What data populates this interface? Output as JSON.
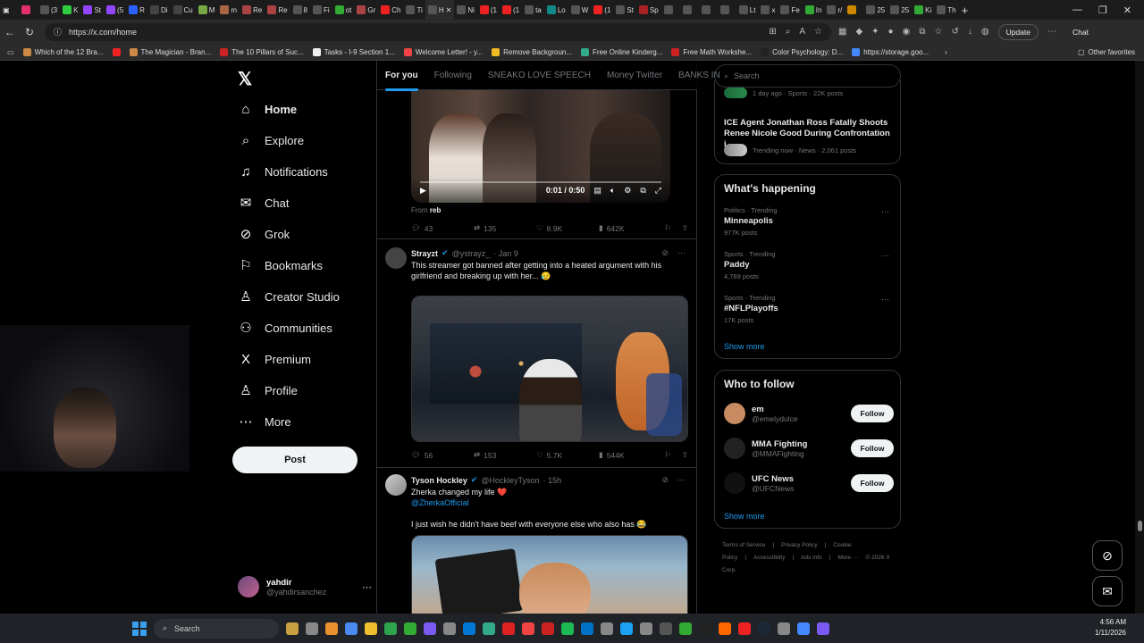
{
  "browser": {
    "tabs": [
      {
        "label": "",
        "color": "#e1306c"
      },
      {
        "label": "(3",
        "color": "#555"
      },
      {
        "label": "K",
        "color": "#2ecc40"
      },
      {
        "label": "St",
        "color": "#9146ff"
      },
      {
        "label": "(5",
        "color": "#9146ff"
      },
      {
        "label": "R",
        "color": "#2962ff"
      },
      {
        "label": "Di",
        "color": "#444"
      },
      {
        "label": "Cu",
        "color": "#444"
      },
      {
        "label": "M",
        "color": "#7a4"
      },
      {
        "label": "m",
        "color": "#a64"
      },
      {
        "label": "Re",
        "color": "#a44"
      },
      {
        "label": "Re",
        "color": "#a44"
      },
      {
        "label": "8",
        "color": "#555"
      },
      {
        "label": "Fi",
        "color": "#555"
      },
      {
        "label": "ot",
        "color": "#3a3"
      },
      {
        "label": "Gr",
        "color": "#a44"
      },
      {
        "label": "Ch",
        "color": "#e22"
      },
      {
        "label": "Ti",
        "color": "#555"
      },
      {
        "label": "H",
        "color": "#555",
        "active": true
      },
      {
        "label": "Ni",
        "color": "#555"
      },
      {
        "label": "(1",
        "color": "#e22"
      },
      {
        "label": "(1",
        "color": "#e22"
      },
      {
        "label": "ta",
        "color": "#555"
      },
      {
        "label": "Lo",
        "color": "#188"
      },
      {
        "label": "W",
        "color": "#555"
      },
      {
        "label": "(1",
        "color": "#e22"
      },
      {
        "label": "St",
        "color": "#555"
      },
      {
        "label": "Sp",
        "color": "#a22"
      },
      {
        "label": "",
        "color": "#555"
      },
      {
        "label": "",
        "color": "#555"
      },
      {
        "label": "",
        "color": "#555"
      },
      {
        "label": "",
        "color": "#555"
      },
      {
        "label": "Lt",
        "color": "#555"
      },
      {
        "label": "x",
        "color": "#555"
      },
      {
        "label": "Fe",
        "color": "#555"
      },
      {
        "label": "In",
        "color": "#3a3"
      },
      {
        "label": "r/",
        "color": "#555"
      },
      {
        "label": "",
        "color": "#c80"
      },
      {
        "label": "25",
        "color": "#555"
      },
      {
        "label": "25",
        "color": "#555"
      },
      {
        "label": "Ki",
        "color": "#3a3"
      },
      {
        "label": "Th",
        "color": "#555"
      }
    ],
    "url": "https://x.com/home",
    "update_label": "Update",
    "chat_label": "Chat",
    "bookmarks": [
      {
        "label": "Which of the 12 Bra...",
        "color": "#c84"
      },
      {
        "label": "",
        "color": "#e22"
      },
      {
        "label": "The Magician - Bran...",
        "color": "#c84"
      },
      {
        "label": "The 10 Pillars of Suc...",
        "color": "#c22"
      },
      {
        "label": "Tasks - I-9 Section 1...",
        "color": "#eee"
      },
      {
        "label": "Welcome Letter! - y...",
        "color": "#e44"
      },
      {
        "label": "Remove Backgroun...",
        "color": "#eb2"
      },
      {
        "label": "Free Online Kinderg...",
        "color": "#3a8"
      },
      {
        "label": "Free Math Workshe...",
        "color": "#c22"
      },
      {
        "label": "Color Psychology: D...",
        "color": "#222"
      },
      {
        "label": "https://storage.goo...",
        "color": "#48f"
      }
    ],
    "other_favorites": "Other favorites"
  },
  "nav": {
    "items": [
      {
        "label": "Home",
        "icon": "⌂"
      },
      {
        "label": "Explore",
        "icon": "⌕"
      },
      {
        "label": "Notifications",
        "icon": "♫"
      },
      {
        "label": "Chat",
        "icon": "✉"
      },
      {
        "label": "Grok",
        "icon": "⊘"
      },
      {
        "label": "Bookmarks",
        "icon": "⚐"
      },
      {
        "label": "Creator Studio",
        "icon": "♙"
      },
      {
        "label": "Communities",
        "icon": "⚇"
      },
      {
        "label": "Premium",
        "icon": "X"
      },
      {
        "label": "Profile",
        "icon": "♙"
      },
      {
        "label": "More",
        "icon": "⋯"
      }
    ],
    "post_label": "Post",
    "account": {
      "name": "yahdir",
      "handle": "@yahdirsanchez"
    }
  },
  "feed": {
    "tabs": [
      "For you",
      "Following",
      "SNEAKO LOVE SPEECH",
      "Money Twitter",
      "BANKS IN"
    ],
    "tweet0": {
      "video_time": "0:01 / 0:50",
      "from_prefix": "From",
      "from_user": "reb",
      "replies": "43",
      "reposts": "135",
      "likes": "8.9K",
      "views": "642K"
    },
    "tweet1": {
      "name": "Strayzt",
      "handle": "@ystrayz_",
      "time": "· Jan 9",
      "text": "This streamer got banned after getting into a heated argument with his girlfriend and breaking up with her... 😥",
      "replies": "56",
      "reposts": "153",
      "likes": "5.7K",
      "views": "544K"
    },
    "tweet2": {
      "name": "Tyson Hockley",
      "handle": "@HockleyTyson",
      "time": "· 15h",
      "line1": "Zherka changed my life ❤️",
      "mention": "@ZherkaOfficial",
      "line2": "I just wish he didn't have beef with everyone else who also has 😂"
    }
  },
  "sidebar": {
    "search_placeholder": "Search",
    "top_meta": "1 day ago · Sports · 22K posts",
    "news_title": "ICE Agent Jonathan Ross Fatally Shoots Renee Nicole Good During Confrontation i...",
    "news_meta": "Trending now · News · 2,061 posts",
    "happening_title": "What's happening",
    "trends": [
      {
        "top": "Politics · Trending",
        "title": "Minneapolis",
        "count": "977K posts"
      },
      {
        "top": "Sports · Trending",
        "title": "Paddy",
        "count": "4,769 posts"
      },
      {
        "top": "Sports · Trending",
        "title": "#NFLPlayoffs",
        "count": "17K posts"
      }
    ],
    "show_more": "Show more",
    "who_title": "Who to follow",
    "follow": [
      {
        "name": "em",
        "handle": "@emelydulce",
        "color": "#c88a60"
      },
      {
        "name": "MMA Fighting",
        "handle": "@MMAFighting",
        "color": "#222"
      },
      {
        "name": "UFC News",
        "handle": "@UFCNews",
        "color": "#111"
      }
    ],
    "follow_label": "Follow",
    "show_more2": "Show more",
    "footer": [
      "Terms of Service",
      "|",
      "Privacy Policy",
      "|",
      "Cookie Policy",
      "|",
      "Accessibility",
      "|",
      "Ads info",
      "|",
      "More ···",
      "© 2026 X Corp."
    ]
  },
  "taskbar": {
    "search_label": "Search",
    "time": "4:56 AM",
    "date": "1/11/2026"
  }
}
